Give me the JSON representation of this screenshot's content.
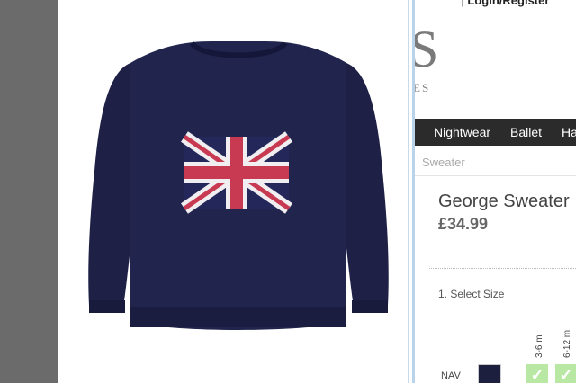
{
  "header": {
    "top_links_prefix": "|",
    "login": "Login",
    "separator": "/",
    "register": "Register"
  },
  "logo": {
    "visible_tail": "S",
    "sub_tail": "ES"
  },
  "nav": {
    "items": [
      "Nightwear",
      "Ballet",
      "Ha"
    ]
  },
  "breadcrumb": {
    "current": "Sweater"
  },
  "product": {
    "name": "George Sweater",
    "price": "£34.99",
    "select_size_label": "1. Select Size",
    "sizes": [
      "3-6 m",
      "6-12 m"
    ],
    "colour_code": "NAV",
    "colour_hex": "#1d1f3f"
  },
  "image": {
    "alt": "Navy sweater with Union Jack flag"
  },
  "colors": {
    "nav_bg": "#2b2b2b",
    "popup_border": "#b9d3ea",
    "available": "#b9e8a4"
  }
}
